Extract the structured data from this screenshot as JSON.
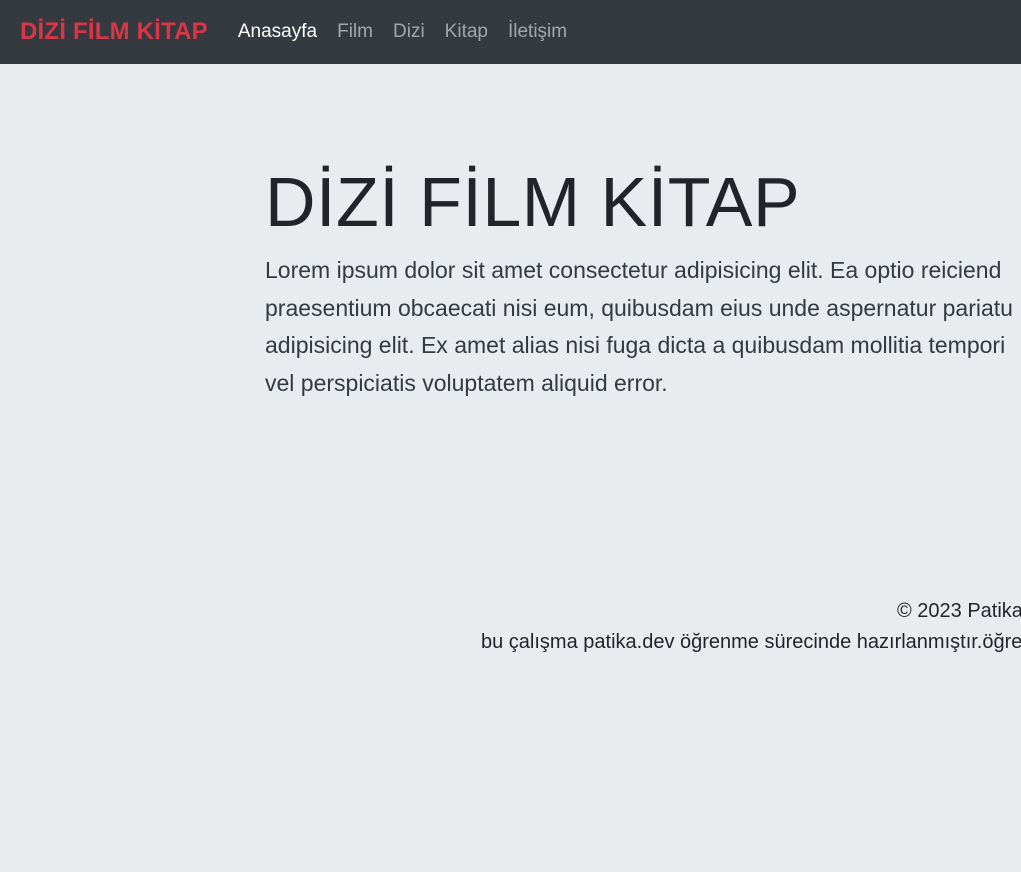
{
  "navbar": {
    "brand": "DİZİ FİLM KİTAP",
    "links": [
      {
        "label": "Anasayfa",
        "active": true
      },
      {
        "label": "Film",
        "active": false
      },
      {
        "label": "Dizi",
        "active": false
      },
      {
        "label": "Kitap",
        "active": false
      },
      {
        "label": "İletişim",
        "active": false
      }
    ]
  },
  "hero": {
    "title": "DİZİ FİLM KİTAP",
    "lines": [
      "Lorem ipsum dolor sit amet consectetur adipisicing elit. Ea optio reiciend",
      "praesentium obcaecati nisi eum, quibusdam eius unde aspernatur pariatu",
      "adipisicing elit. Ex amet alias nisi fuga dicta a quibusdam mollitia tempori",
      "vel perspiciatis voluptatem aliquid error."
    ]
  },
  "footer": {
    "copyright": "© 2023 Patika",
    "note": "bu çalışma patika.dev öğrenme sürecinde hazırlanmıştır.öğren"
  },
  "colors": {
    "navbar_bg": "#343a40",
    "brand": "#dc3545",
    "page_bg": "#e9ecef"
  }
}
